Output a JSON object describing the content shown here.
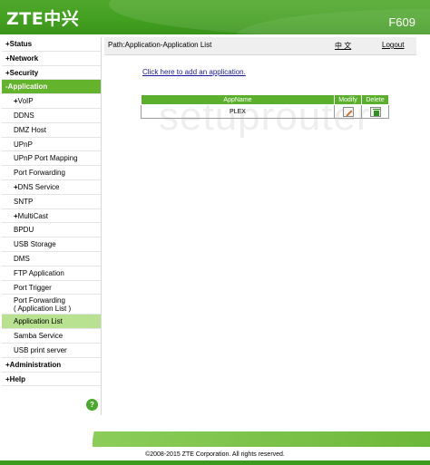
{
  "header": {
    "logo": "ZTE中兴",
    "model": "F609"
  },
  "path": {
    "text": "Path:Application-Application List",
    "language": "中 文",
    "logout": "Logout"
  },
  "sidebar": {
    "items": [
      {
        "label": "Status",
        "prefix": "+",
        "level": "top"
      },
      {
        "label": "Network",
        "prefix": "+",
        "level": "top"
      },
      {
        "label": "Security",
        "prefix": "+",
        "level": "top"
      },
      {
        "label": "Application",
        "prefix": "-",
        "level": "top-active"
      },
      {
        "label": "VoIP",
        "prefix": "+",
        "level": "sub"
      },
      {
        "label": "DDNS",
        "prefix": "",
        "level": "sub"
      },
      {
        "label": "DMZ Host",
        "prefix": "",
        "level": "sub"
      },
      {
        "label": "UPnP",
        "prefix": "",
        "level": "sub"
      },
      {
        "label": "UPnP Port Mapping",
        "prefix": "",
        "level": "sub"
      },
      {
        "label": "Port Forwarding",
        "prefix": "",
        "level": "sub"
      },
      {
        "label": "DNS Service",
        "prefix": "+",
        "level": "sub"
      },
      {
        "label": "SNTP",
        "prefix": "",
        "level": "sub"
      },
      {
        "label": "MultiCast",
        "prefix": "+",
        "level": "sub"
      },
      {
        "label": "BPDU",
        "prefix": "",
        "level": "sub"
      },
      {
        "label": "USB Storage",
        "prefix": "",
        "level": "sub"
      },
      {
        "label": "DMS",
        "prefix": "",
        "level": "sub"
      },
      {
        "label": "FTP Application",
        "prefix": "",
        "level": "sub"
      },
      {
        "label": "Port Trigger",
        "prefix": "",
        "level": "sub"
      },
      {
        "label": "Port Forwarding\n( Application List )",
        "prefix": "",
        "level": "sub-tall"
      },
      {
        "label": "Application List",
        "prefix": "",
        "level": "sub-selected"
      },
      {
        "label": "Samba Service",
        "prefix": "",
        "level": "sub"
      },
      {
        "label": "USB print server",
        "prefix": "",
        "level": "sub"
      },
      {
        "label": "Administration",
        "prefix": "+",
        "level": "top"
      },
      {
        "label": "Help",
        "prefix": "+",
        "level": "top"
      }
    ],
    "help_icon": "?"
  },
  "main": {
    "add_link": "Click here to add an application.",
    "table": {
      "headers": [
        "AppName",
        "Modify",
        "Delete"
      ],
      "rows": [
        {
          "name": "PLEX"
        }
      ]
    }
  },
  "watermark": "setuprouter",
  "footer": {
    "copyright": "©2008-2015 ZTE Corporation. All rights reserved."
  },
  "colors": {
    "brand_green": "#43a021",
    "menu_active": "#64b32c",
    "menu_selected": "#b9e290",
    "table_header": "#5aaf2c"
  },
  "icons": {
    "modify": "pencil-icon",
    "delete": "trash-icon"
  }
}
